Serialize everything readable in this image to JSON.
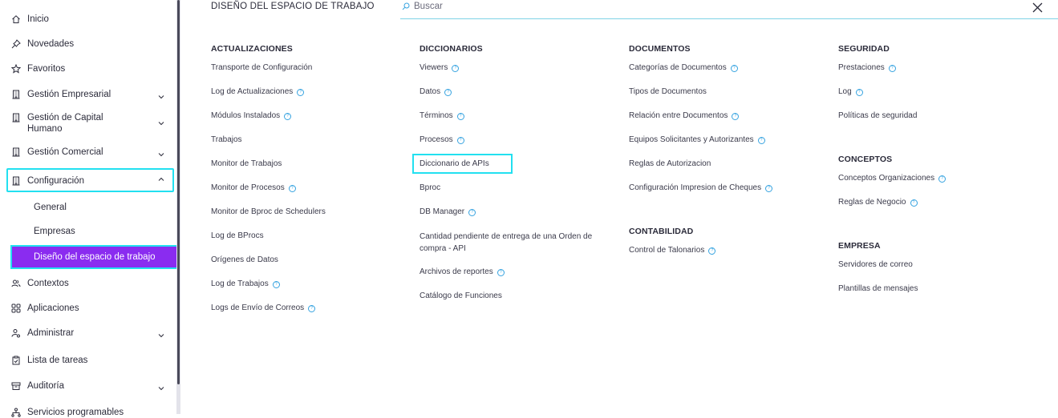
{
  "sidebar": {
    "items": [
      {
        "label": "Inicio",
        "icon": "home-icon"
      },
      {
        "label": "Novedades",
        "icon": "pin-icon"
      },
      {
        "label": "Favoritos",
        "icon": "star-icon"
      },
      {
        "label": "Gestión Empresarial",
        "icon": "building-icon"
      },
      {
        "label": "Gestión de Capital Humano",
        "icon": "building-icon"
      },
      {
        "label": "Gestión Comercial",
        "icon": "building-icon"
      },
      {
        "label": "Configuración",
        "icon": "building-icon"
      },
      {
        "label": "Contextos",
        "icon": "users-icon"
      },
      {
        "label": "Aplicaciones",
        "icon": "grid-icon"
      },
      {
        "label": "Administrar",
        "icon": "user-gear-icon"
      },
      {
        "label": "Lista de tareas",
        "icon": "clipboard-check-icon"
      },
      {
        "label": "Auditoría",
        "icon": "archive-icon"
      },
      {
        "label": "Servicios programables",
        "icon": "network-icon"
      }
    ],
    "config_subitems": [
      "General",
      "Empresas",
      "Diseño del espacio de trabajo"
    ]
  },
  "header": {
    "title": "DISEÑO DEL ESPACIO DE TRABAJO",
    "search_placeholder": "Buscar"
  },
  "columns": {
    "actualizaciones": {
      "title": "ACTUALIZACIONES",
      "links": [
        "Transporte de Configuración",
        "Log de Actualizaciones",
        "Módulos Instalados",
        "Trabajos",
        "Monitor de Trabajos",
        "Monitor de Procesos",
        "Monitor de Bproc de Schedulers",
        "Log de BProcs",
        "Orígenes de Datos",
        "Log de Trabajos",
        "Logs de Envío de Correos"
      ]
    },
    "diccionarios": {
      "title": "DICCIONARIOS",
      "links": [
        "Viewers",
        "Datos",
        "Términos",
        "Procesos",
        "Diccionario de APIs",
        "Bproc",
        "DB Manager",
        "Cantidad pendiente de entrega de una Orden de compra - API",
        "Archivos de reportes",
        "Catálogo de Funciones"
      ]
    },
    "documentos": {
      "title": "DOCUMENTOS",
      "links": [
        "Categorías de Documentos",
        "Tipos de Documentos",
        "Relación entre Documentos",
        "Equipos Solicitantes y Autorizantes",
        "Reglas de Autorizacion",
        "Configuración Impresion de Cheques"
      ]
    },
    "contabilidad": {
      "title": "CONTABILIDAD",
      "links": [
        "Control de Talonarios"
      ]
    },
    "seguridad": {
      "title": "SEGURIDAD",
      "links": [
        "Prestaciones",
        "Log",
        "Políticas de seguridad"
      ]
    },
    "conceptos": {
      "title": "CONCEPTOS",
      "links": [
        "Conceptos Organizaciones",
        "Reglas de Negocio"
      ]
    },
    "empresa": {
      "title": "EMPRESA",
      "links": [
        "Servidores de correo",
        "Plantillas de mensajes"
      ]
    }
  },
  "colors": {
    "accent": "#8a2cf0",
    "highlight": "#22e0f0",
    "help": "#36a3e0"
  }
}
